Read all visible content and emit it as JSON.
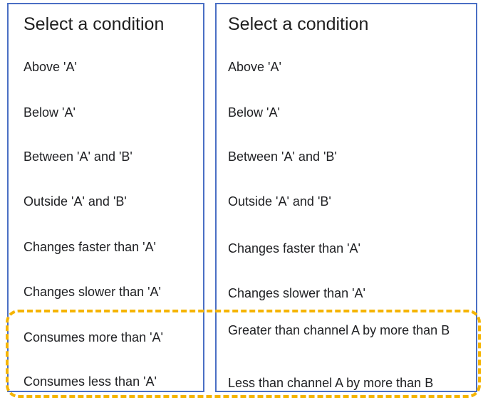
{
  "left_panel": {
    "title": "Select a condition",
    "options": [
      "Above 'A'",
      "Below 'A'",
      "Between 'A' and 'B'",
      "Outside 'A' and 'B'",
      "Changes faster than 'A'",
      "Changes slower than 'A'",
      "Consumes more than 'A'",
      "Consumes less than 'A'"
    ]
  },
  "right_panel": {
    "title": "Select a condition",
    "options": [
      "Above 'A'",
      "Below 'A'",
      "Between 'A' and 'B'",
      "Outside 'A' and 'B'",
      "Changes faster than 'A'",
      "Changes slower than 'A'",
      "Greater than channel A by more than B",
      "Less than channel A by more than B"
    ]
  },
  "colors": {
    "panel_border": "#4a6fc4",
    "highlight_border": "#f5b400"
  }
}
